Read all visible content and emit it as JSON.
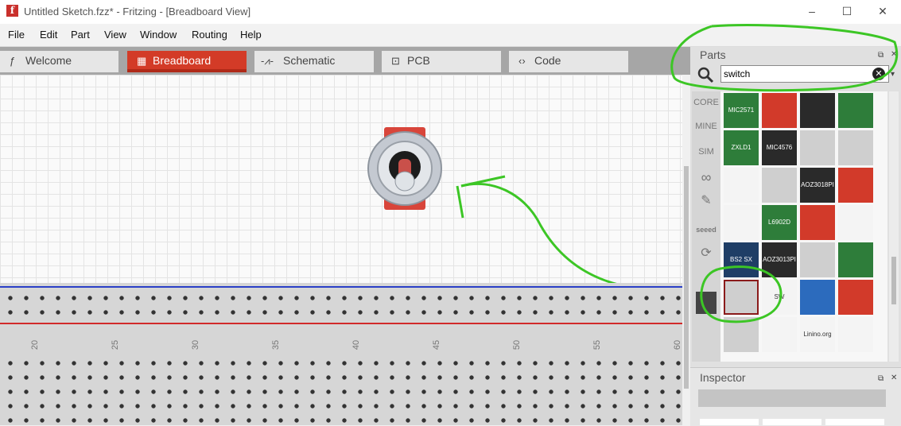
{
  "window": {
    "title": "Untitled Sketch.fzz* - Fritzing - [Breadboard View]",
    "logo_letter": "f",
    "minimize": "–",
    "maximize": "☐",
    "close": "✕"
  },
  "menu": [
    "File",
    "Edit",
    "Part",
    "View",
    "Window",
    "Routing",
    "Help"
  ],
  "tabs": [
    {
      "label": "Welcome",
      "icon": "ƒ"
    },
    {
      "label": "Breadboard",
      "icon": "▦"
    },
    {
      "label": "Schematic",
      "icon": "-⩘-"
    },
    {
      "label": "PCB",
      "icon": "⊡"
    },
    {
      "label": "Code",
      "icon": "‹›"
    }
  ],
  "breadboard": {
    "row_numbers": [
      "20",
      "25",
      "30",
      "35",
      "40",
      "45",
      "50",
      "55",
      "60"
    ]
  },
  "parts_panel": {
    "title": "Parts",
    "search_value": "switch",
    "bins": [
      "CORE",
      "MINE",
      "SIM",
      "∞",
      "✎",
      "seeed",
      "⟳",
      "",
      ""
    ],
    "tiles": [
      {
        "color": "green",
        "label": "MIC2571"
      },
      {
        "color": "red",
        "label": ""
      },
      {
        "color": "black",
        "label": ""
      },
      {
        "color": "green",
        "label": ""
      },
      {
        "color": "green",
        "label": "ZXLD1"
      },
      {
        "color": "black",
        "label": "MIC4576"
      },
      {
        "color": "grey",
        "label": ""
      },
      {
        "color": "grey",
        "label": ""
      },
      {
        "color": "white",
        "label": ""
      },
      {
        "color": "grey",
        "label": ""
      },
      {
        "color": "black",
        "label": "AOZ3018PI"
      },
      {
        "color": "red",
        "label": ""
      },
      {
        "color": "white",
        "label": ""
      },
      {
        "color": "green",
        "label": "L6902D"
      },
      {
        "color": "red",
        "label": ""
      },
      {
        "color": "white",
        "label": ""
      },
      {
        "color": "navy",
        "label": "BS2 SX"
      },
      {
        "color": "black",
        "label": "AOZ3013PI"
      },
      {
        "color": "grey",
        "label": ""
      },
      {
        "color": "green",
        "label": ""
      },
      {
        "color": "grey",
        "label": ""
      },
      {
        "color": "white",
        "label": "SW"
      },
      {
        "color": "blue",
        "label": ""
      },
      {
        "color": "red",
        "label": ""
      },
      {
        "color": "grey",
        "label": ""
      },
      {
        "color": "white",
        "label": ""
      },
      {
        "color": "white",
        "label": "Linino.org"
      },
      {
        "color": "white",
        "label": ""
      }
    ]
  },
  "inspector": {
    "title": "Inspector"
  }
}
